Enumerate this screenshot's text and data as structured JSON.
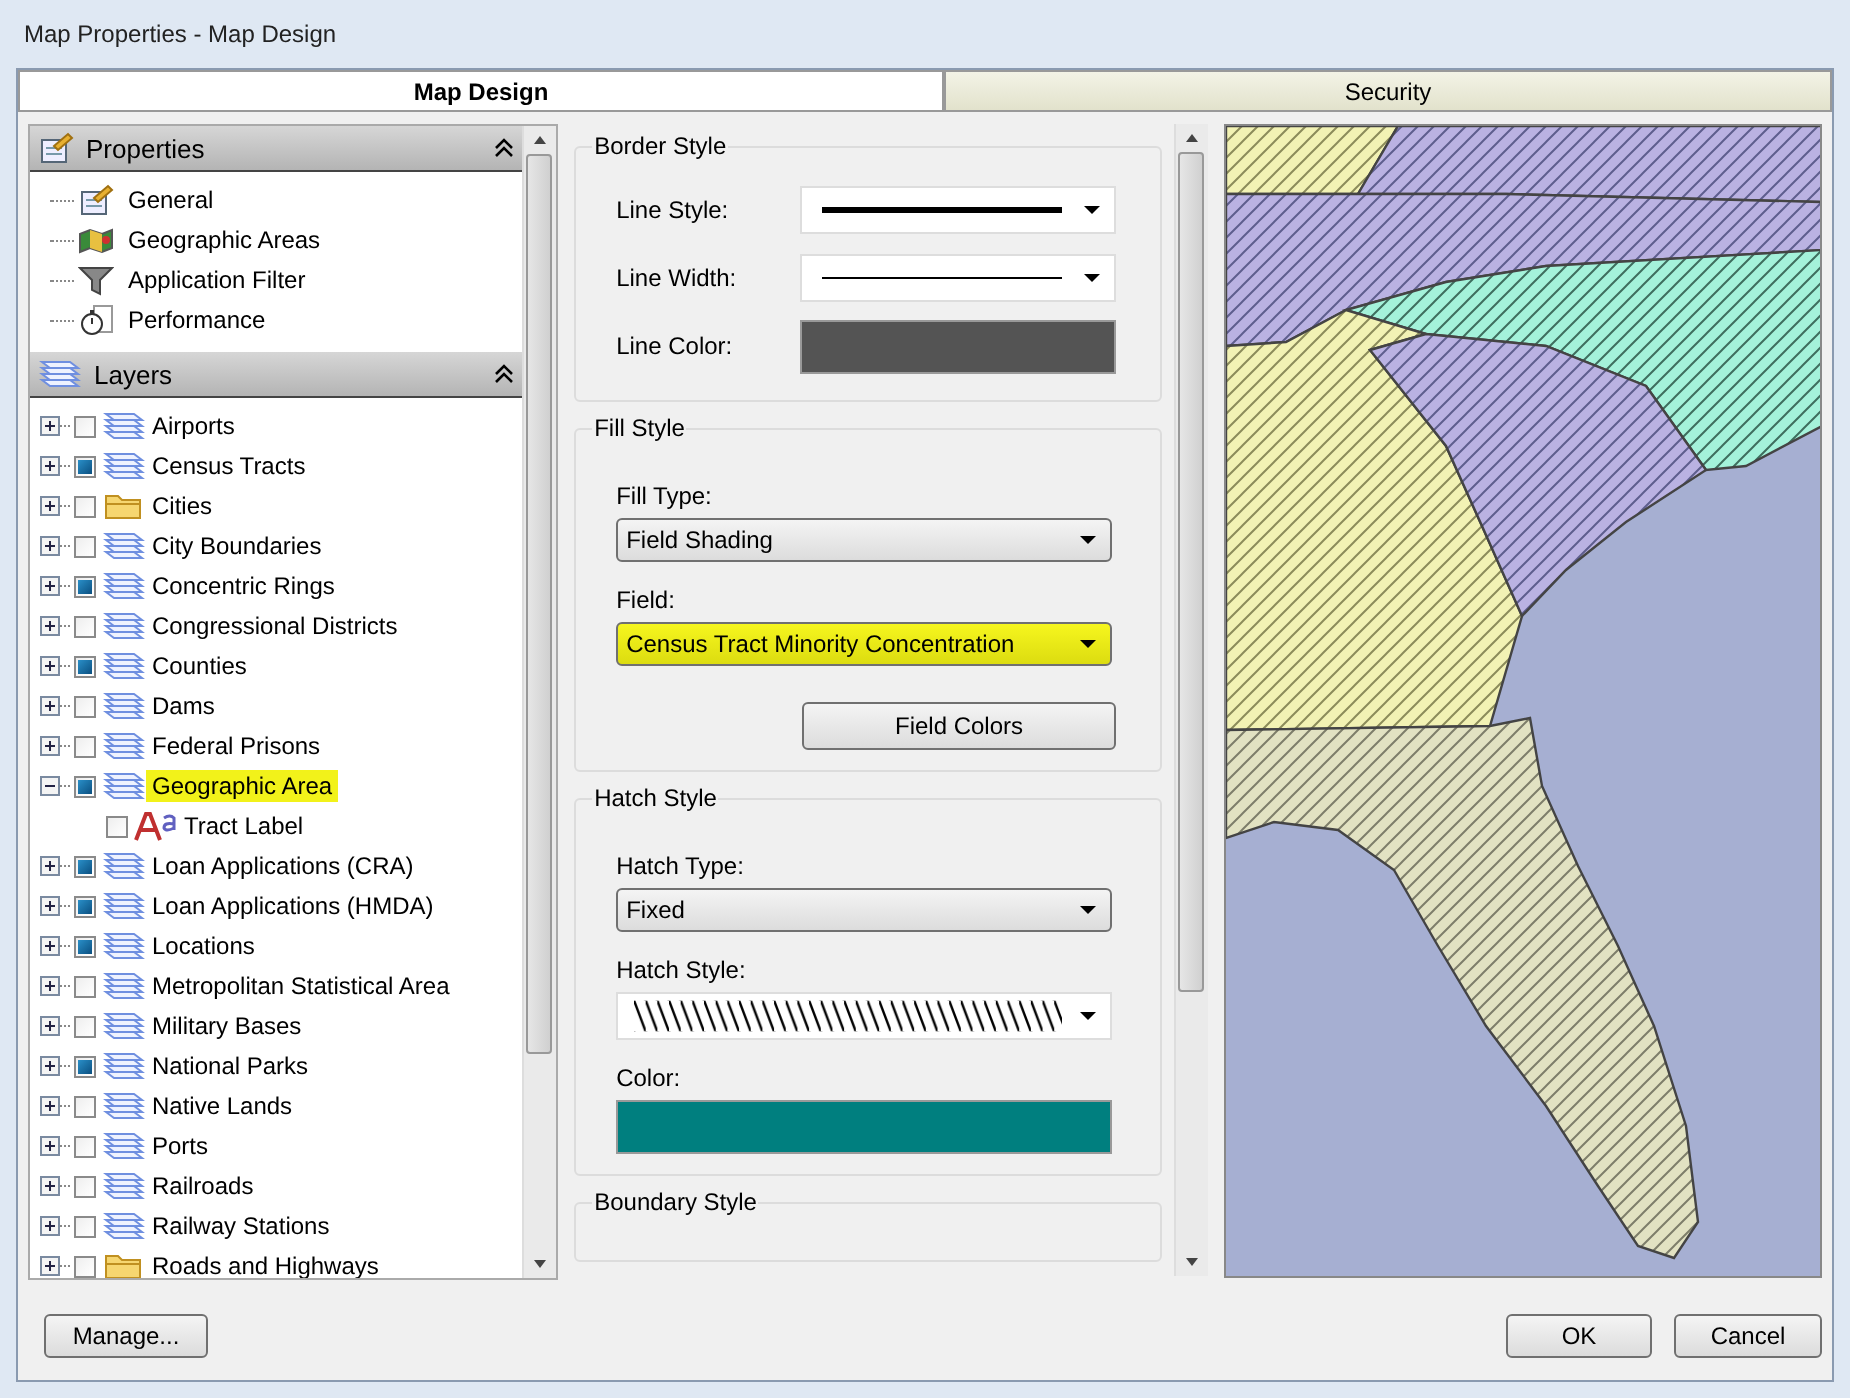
{
  "window": {
    "title": "Map Properties - Map Design"
  },
  "tabs": [
    {
      "label": "Map Design",
      "selected": true
    },
    {
      "label": "Security",
      "selected": false
    }
  ],
  "properties_panel": {
    "title": "Properties",
    "items": [
      {
        "label": "General",
        "kind": "properties"
      },
      {
        "label": "Geographic Areas",
        "kind": "map"
      },
      {
        "label": "Application Filter",
        "kind": "filter"
      },
      {
        "label": "Performance",
        "kind": "stopwatch"
      }
    ]
  },
  "layers_panel": {
    "title": "Layers",
    "items": [
      {
        "label": "Airports",
        "kind": "layer",
        "checked": false,
        "expanded": false,
        "highlighted": false
      },
      {
        "label": "Census Tracts",
        "kind": "layer",
        "checked": true,
        "expanded": false,
        "highlighted": false
      },
      {
        "label": "Cities",
        "kind": "folder",
        "checked": false,
        "expanded": false,
        "highlighted": false
      },
      {
        "label": "City Boundaries",
        "kind": "layer",
        "checked": false,
        "expanded": false,
        "highlighted": false
      },
      {
        "label": "Concentric Rings",
        "kind": "layer",
        "checked": true,
        "expanded": false,
        "highlighted": false
      },
      {
        "label": "Congressional Districts",
        "kind": "layer",
        "checked": false,
        "expanded": false,
        "highlighted": false
      },
      {
        "label": "Counties",
        "kind": "layer",
        "checked": true,
        "expanded": false,
        "highlighted": false
      },
      {
        "label": "Dams",
        "kind": "layer",
        "checked": false,
        "expanded": false,
        "highlighted": false
      },
      {
        "label": "Federal Prisons",
        "kind": "layer",
        "checked": false,
        "expanded": false,
        "highlighted": false
      },
      {
        "label": "Geographic Area",
        "kind": "layer",
        "checked": true,
        "expanded": true,
        "highlighted": true,
        "children": [
          {
            "label": "Tract Label",
            "kind": "label",
            "checked": false,
            "highlighted": false
          }
        ]
      },
      {
        "label": "Loan Applications (CRA)",
        "kind": "layer",
        "checked": true,
        "expanded": false,
        "highlighted": false
      },
      {
        "label": "Loan Applications (HMDA)",
        "kind": "layer",
        "checked": true,
        "expanded": false,
        "highlighted": false
      },
      {
        "label": "Locations",
        "kind": "layer",
        "checked": true,
        "expanded": false,
        "highlighted": false
      },
      {
        "label": "Metropolitan Statistical Area",
        "kind": "layer",
        "checked": false,
        "expanded": false,
        "highlighted": false
      },
      {
        "label": "Military Bases",
        "kind": "layer",
        "checked": false,
        "expanded": false,
        "highlighted": false
      },
      {
        "label": "National Parks",
        "kind": "layer",
        "checked": true,
        "expanded": false,
        "highlighted": false
      },
      {
        "label": "Native Lands",
        "kind": "layer",
        "checked": false,
        "expanded": false,
        "highlighted": false
      },
      {
        "label": "Ports",
        "kind": "layer",
        "checked": false,
        "expanded": false,
        "highlighted": false
      },
      {
        "label": "Railroads",
        "kind": "layer",
        "checked": false,
        "expanded": false,
        "highlighted": false
      },
      {
        "label": "Railway Stations",
        "kind": "layer",
        "checked": false,
        "expanded": false,
        "highlighted": false
      },
      {
        "label": "Roads and Highways",
        "kind": "folder",
        "checked": false,
        "expanded": false,
        "highlighted": false
      }
    ]
  },
  "form": {
    "sections": [
      {
        "title": "Border Style",
        "fields": [
          {
            "label": "Line Style:",
            "kind": "thickline"
          },
          {
            "label": "Line Width:",
            "kind": "thinline"
          },
          {
            "label": "Line Color:",
            "kind": "color",
            "color": "#545454"
          }
        ]
      },
      {
        "title": "Fill Style",
        "fields": [
          {
            "label": "Fill Type:",
            "kind": "select",
            "value": "Field Shading",
            "highlighted": false
          },
          {
            "label": "Field:",
            "kind": "select",
            "value": "Census Tract Minority Concentration",
            "highlighted": true
          }
        ],
        "button": "Field Colors"
      },
      {
        "title": "Hatch Style",
        "fields": [
          {
            "label": "Hatch Type:",
            "kind": "select",
            "value": "Fixed",
            "highlighted": false
          },
          {
            "label": "Hatch Style:",
            "kind": "hatch"
          },
          {
            "label": "Color:",
            "kind": "color",
            "color": "#007f7f"
          }
        ]
      },
      {
        "title": "Boundary Style"
      }
    ]
  },
  "footer": {
    "left_button": "Manage...",
    "buttons": [
      "OK",
      "Cancel"
    ]
  }
}
